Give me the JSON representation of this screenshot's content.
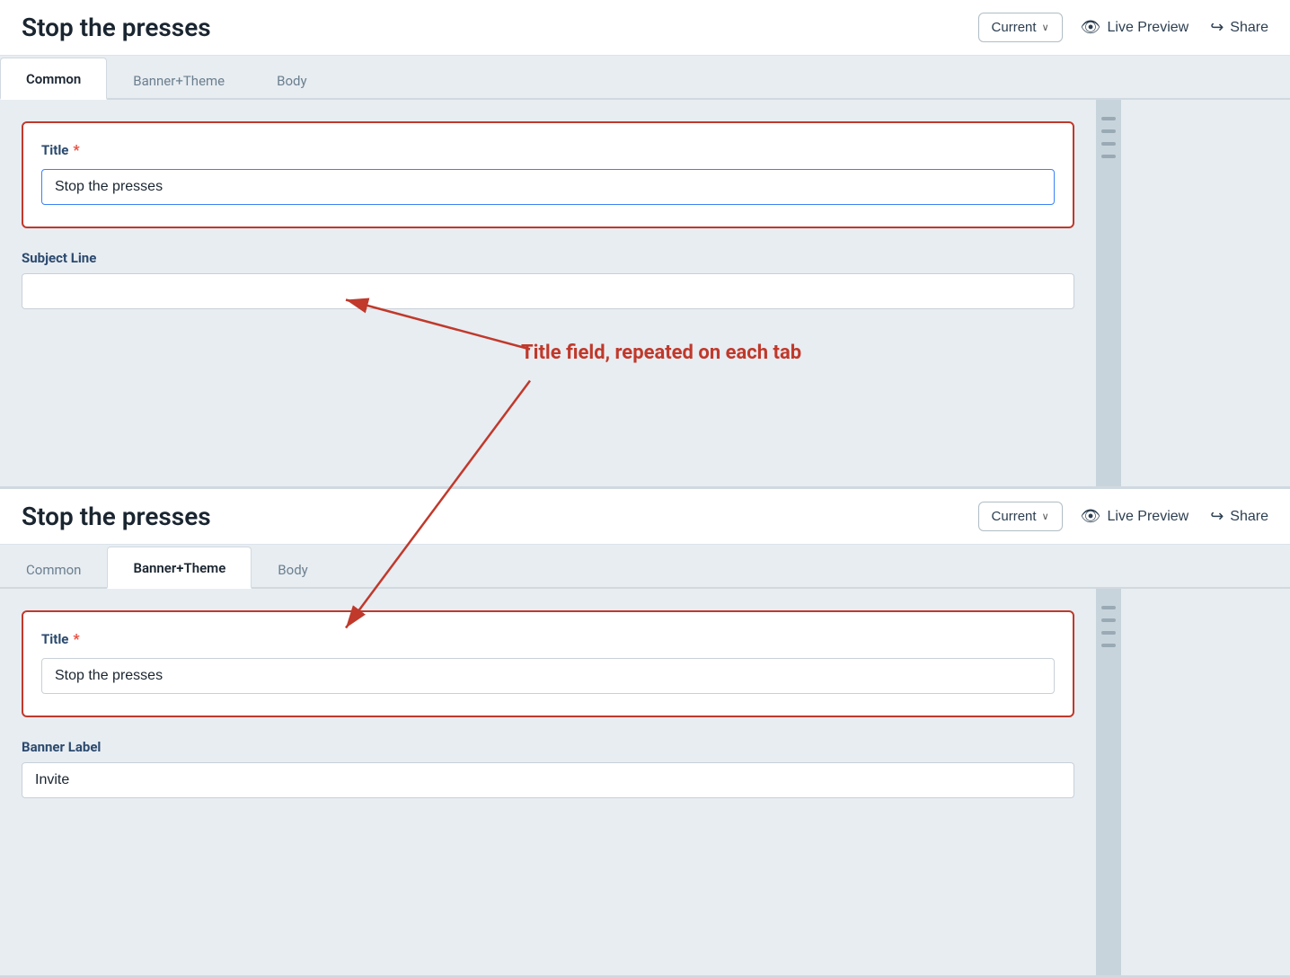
{
  "app": {
    "title": "Stop the presses"
  },
  "header": {
    "title": "Stop the presses",
    "version_label": "Current",
    "chevron": "∨",
    "live_preview_label": "Live Preview",
    "share_label": "Share"
  },
  "tabs": {
    "items": [
      {
        "id": "common",
        "label": "Common"
      },
      {
        "id": "banner-theme",
        "label": "Banner+Theme"
      },
      {
        "id": "body",
        "label": "Body"
      }
    ],
    "active_top": "common",
    "active_bottom": "banner-theme"
  },
  "top_form": {
    "title_label": "Title",
    "title_required": "*",
    "title_value": "Stop the presses",
    "subject_line_label": "Subject Line",
    "subject_line_placeholder": ""
  },
  "bottom_form": {
    "title_label": "Title",
    "title_required": "*",
    "title_value": "Stop the presses",
    "banner_label_label": "Banner Label",
    "banner_label_value": "Invite"
  },
  "annotation": {
    "text": "Title field, repeated on each tab"
  }
}
